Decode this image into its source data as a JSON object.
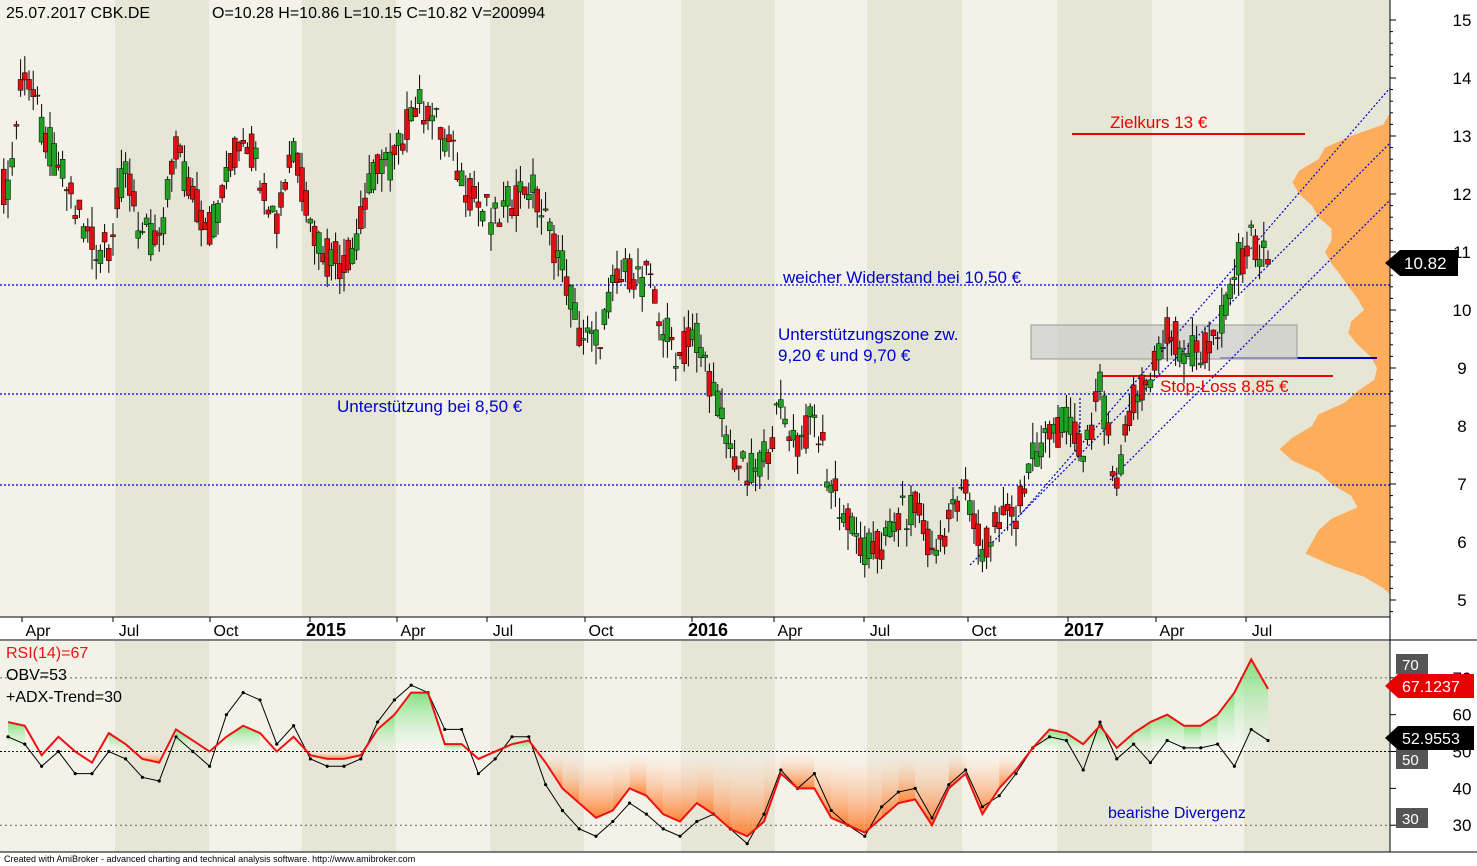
{
  "header": {
    "date_symbol": "25.07.2017 CBK.DE",
    "ohlcv": "O=10.28  H=10.86  L=10.15  C=10.82  V=200994"
  },
  "price_axis": {
    "ticks": [
      "15",
      "14",
      "13",
      "12",
      "11",
      "10",
      "9",
      "8",
      "7",
      "6",
      "5"
    ],
    "last_price": "10.82"
  },
  "time_axis": {
    "labels": [
      "Apr",
      "Jul",
      "Oct",
      "2015",
      "Apr",
      "Jul",
      "Oct",
      "2016",
      "Apr",
      "Jul",
      "Oct",
      "2017",
      "Apr",
      "Jul"
    ]
  },
  "annotations": {
    "target": "Zielkurs 13 €",
    "soft_resistance": "weicher Widerstand bei 10,50 €",
    "support_zone_line1": "Unterstützungszone zw.",
    "support_zone_line2": "9,20 € und 9,70 €",
    "stop_loss": "Stop-Loss 8,85 €",
    "support": "Unterstützung bei 8,50 €",
    "divergence": "bearishe Divergenz"
  },
  "indicator": {
    "rsi_label": "RSI(14)=67",
    "obv_label": "OBV=53",
    "adx_label": "+ADX-Trend=30",
    "axis_ticks": [
      "70",
      "60",
      "50",
      "40",
      "30"
    ],
    "badge_70": "70",
    "badge_50": "50",
    "badge_30": "30",
    "rsi_value": "67.1237",
    "obv_value": "52.9553"
  },
  "footer": "Created with AmiBroker - advanced charting and technical analysis software. http://www.amibroker.com",
  "colors": {
    "up": "#22a022",
    "down": "#dd1111",
    "rsi": "#ee1111",
    "volume_profile": "#ffaa55",
    "guide": "#0000cc"
  },
  "chart_data": [
    {
      "type": "candlestick",
      "symbol": "CBK.DE",
      "xlabel": "",
      "ylabel": "",
      "ylim": [
        4.8,
        15.2
      ],
      "last": 10.82,
      "horizontal_levels": [
        10.5,
        8.5,
        7.0,
        13.0,
        8.85,
        9.2
      ],
      "support_zone": [
        9.2,
        9.7
      ],
      "closes": [
        12.2,
        14.2,
        13.1,
        12.5,
        11.7,
        11.1,
        11.2,
        12.4,
        11.3,
        11.1,
        12.8,
        11.9,
        11.4,
        12.2,
        13.1,
        12.4,
        11.5,
        12.9,
        11.5,
        10.9,
        10.8,
        11.5,
        12.6,
        12.5,
        13.5,
        13.5,
        12.9,
        12.3,
        11.8,
        11.5,
        11.9,
        12.2,
        11.5,
        10.8,
        9.6,
        9.4,
        10.3,
        10.7,
        10.5,
        9.7,
        9.2,
        9.6,
        8.6,
        7.6,
        7.1,
        7.5,
        8.3,
        7.7,
        8.1,
        7.0,
        6.3,
        5.8,
        5.9,
        6.4,
        6.6,
        5.7,
        6.4,
        6.8,
        5.8,
        6.3,
        6.5,
        7.4,
        7.9,
        8.0,
        7.6,
        8.6,
        7.1,
        8.4,
        8.8,
        9.6,
        9.4,
        9.2,
        9.5,
        10.7,
        11.2,
        10.82
      ],
      "rsi_ylim": [
        23,
        80
      ],
      "rsi": [
        58,
        57,
        49,
        54,
        50,
        47,
        55,
        52,
        48,
        47,
        56,
        53,
        50,
        54,
        57,
        55,
        50,
        54,
        49,
        48,
        48,
        49,
        56,
        60,
        66,
        66,
        52,
        52,
        48,
        50,
        52,
        53,
        47,
        40,
        36,
        32,
        34,
        40,
        38,
        33,
        31,
        36,
        33,
        29,
        27,
        31,
        44,
        40,
        40,
        32,
        30,
        28,
        32,
        36,
        37,
        30,
        40,
        44,
        33,
        40,
        45,
        51,
        56,
        55,
        52,
        57,
        51,
        55,
        58,
        60,
        57,
        57,
        60,
        66,
        75,
        67
      ],
      "obv": [
        54,
        52,
        46,
        50,
        44,
        44,
        50,
        48,
        43,
        42,
        54,
        50,
        46,
        60,
        66,
        64,
        52,
        57,
        48,
        46,
        46,
        48,
        58,
        64,
        68,
        66,
        56,
        56,
        44,
        48,
        54,
        54,
        41,
        34,
        29,
        27,
        31,
        36,
        33,
        29,
        27,
        31,
        33,
        29,
        25,
        33,
        45,
        40,
        44,
        34,
        30,
        27,
        35,
        39,
        40,
        32,
        41,
        45,
        35,
        38,
        44,
        51,
        54,
        53,
        45,
        58,
        48,
        52,
        47,
        53,
        51,
        51,
        52,
        46,
        56,
        53
      ]
    }
  ]
}
